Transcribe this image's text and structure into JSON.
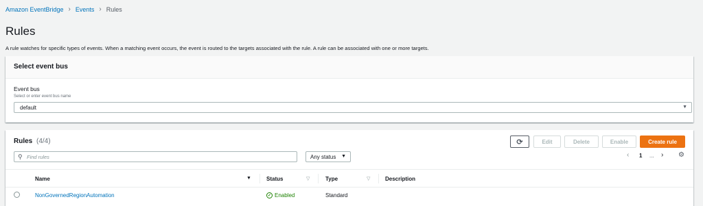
{
  "breadcrumb": {
    "items": [
      "Amazon EventBridge",
      "Events"
    ],
    "current": "Rules",
    "separator": "›"
  },
  "page": {
    "title": "Rules",
    "description": "A rule watches for specific types of events. When a matching event occurs, the event is routed to the targets associated with the rule. A rule can be associated with one or more targets."
  },
  "event_bus_panel": {
    "header": "Select event bus",
    "label": "Event bus",
    "hint": "Select or enter event bus name",
    "selected": "default"
  },
  "rules_panel": {
    "title": "Rules",
    "count": "(4/4)",
    "buttons": {
      "edit": "Edit",
      "delete": "Delete",
      "enable": "Enable",
      "create": "Create rule"
    },
    "search_placeholder": "Find rules",
    "status_filter": "Any status",
    "pagination": {
      "current_page": "1",
      "ellipsis": "..."
    },
    "columns": [
      "Name",
      "Status",
      "Type",
      "Description"
    ],
    "rows": [
      {
        "name": "NonGovernedRegionAutomation",
        "status": "Enabled",
        "type": "Standard",
        "description": ""
      }
    ]
  },
  "colors": {
    "accent": "#ec7211",
    "link": "#0073bb",
    "success": "#1d8102"
  },
  "icons": [
    "refresh-icon",
    "search-icon",
    "caret-down-icon",
    "chevron-left-icon",
    "chevron-right-icon",
    "gear-icon",
    "check-circle-icon"
  ]
}
